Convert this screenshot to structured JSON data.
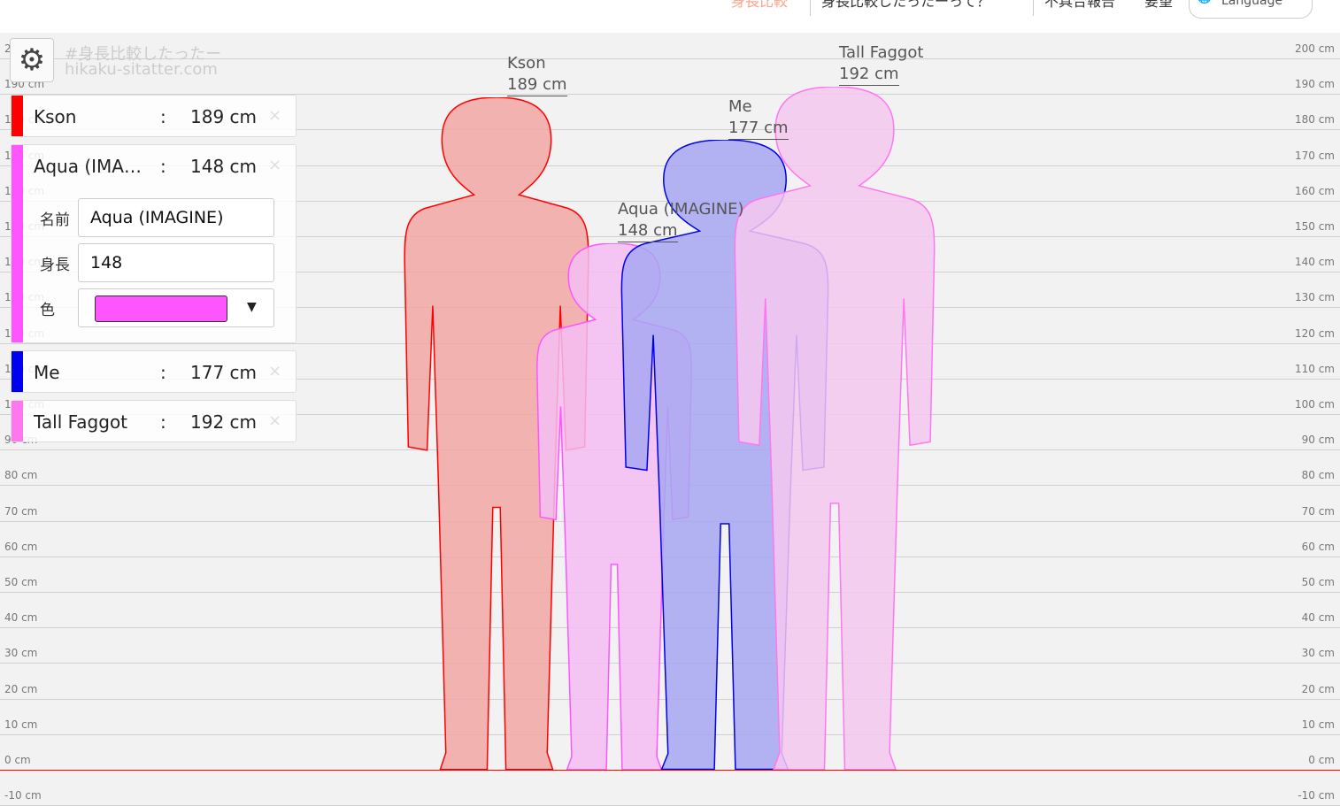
{
  "nav": {
    "items": [
      "身長比較",
      "身長比較したったーって？",
      "不具合報告",
      "要望"
    ],
    "language": "Language"
  },
  "settings": {
    "icon": "gear-icon"
  },
  "watermark": {
    "line1": "#身長比較したったー",
    "line2": "hikaku-sitatter.com"
  },
  "scale": {
    "min_cm": -10,
    "max_cm": 200,
    "step_cm": 10,
    "unit": "cm"
  },
  "people": [
    {
      "name": "Kson",
      "name_short": "Kson",
      "height_cm": 189,
      "height_label": "189 cm",
      "color": "#ff0000",
      "fill": "#f2a7a5"
    },
    {
      "name": "Aqua (IMAGINE)",
      "name_short": "Aqua (IMA…",
      "height_cm": 148,
      "height_label": "148 cm",
      "color": "#ff55ff",
      "fill": "#f5bdf2"
    },
    {
      "name": "Me",
      "name_short": "Me",
      "height_cm": 177,
      "height_label": "177 cm",
      "color": "#0000ee",
      "fill": "#a7a7f2"
    },
    {
      "name": "Tall Faggot",
      "name_short": "Tall Faggot",
      "height_cm": 192,
      "height_label": "192 cm",
      "color": "#ff77ee",
      "fill": "#f5c8ef"
    }
  ],
  "editor": {
    "name_label": "名前",
    "name_value": "Aqua (IMAGINE)",
    "height_label": "身長",
    "height_value": "148",
    "color_label": "色",
    "color_value": "#ff55ff",
    "dropdown": "▼"
  },
  "colon": ":",
  "close": "×"
}
